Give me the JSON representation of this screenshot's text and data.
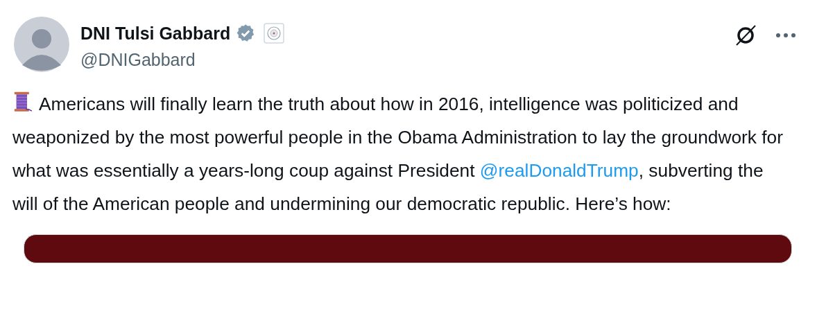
{
  "author": {
    "name": "DNI Tulsi Gabbard",
    "handle": "@DNIGabbard",
    "verified": true
  },
  "post": {
    "segments": [
      {
        "kind": "text",
        "text": "Americans will finally learn the truth about how in 2016, intelligence was politicized and weaponized by the most powerful people in the Obama Administration to lay the groundwork for what was essentially a years-long coup against President "
      },
      {
        "kind": "mention",
        "text": "@realDonaldTrump"
      },
      {
        "kind": "text",
        "text": ", subverting the will of the American people and undermining our democratic republic. Here’s how:"
      }
    ]
  }
}
